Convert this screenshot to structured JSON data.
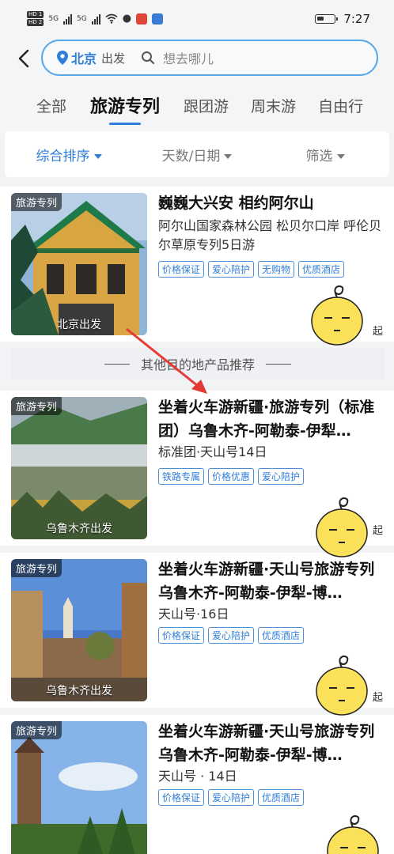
{
  "status_bar": {
    "hd1": "HD 1",
    "hd2": "HD 2",
    "sig1": "5G",
    "sig2": "5G",
    "time": "7:27"
  },
  "search": {
    "city": "北京",
    "depart_label": "出发",
    "placeholder": "想去哪儿"
  },
  "tabs": [
    {
      "label": "全部"
    },
    {
      "label": "旅游专列"
    },
    {
      "label": "跟团游"
    },
    {
      "label": "周末游"
    },
    {
      "label": "自由行"
    }
  ],
  "filters": [
    {
      "label": "综合排序"
    },
    {
      "label": "天数/日期"
    },
    {
      "label": "筛选"
    }
  ],
  "divider_text": "其他目的地产品推荐",
  "price_suffix": "起",
  "products": [
    {
      "badge": "旅游专列",
      "thumb_caption": "北京出发",
      "title": "巍巍大兴安 相约阿尔山",
      "subtitle": "阿尔山国家森林公园 松贝尔口岸 呼伦贝尔草原专列5日游",
      "tags": [
        "价格保证",
        "爱心陪护",
        "无购物",
        "优质酒店"
      ]
    },
    {
      "badge": "旅游专列",
      "thumb_caption": "乌鲁木齐出发",
      "title": "坐着火车游新疆·旅游专列（标准团）乌鲁木齐-阿勒泰-伊犁…",
      "subtitle": "标准团·天山号14日",
      "tags": [
        "铁路专属",
        "价格优惠",
        "爱心陪护"
      ]
    },
    {
      "badge": "旅游专列",
      "thumb_caption": "乌鲁木齐出发",
      "title": "坐着火车游新疆·天山号旅游专列 乌鲁木齐-阿勒泰-伊犁-博…",
      "subtitle": "天山号·16日",
      "tags": [
        "价格保证",
        "爱心陪护",
        "优质酒店"
      ]
    },
    {
      "badge": "旅游专列",
      "thumb_caption": "",
      "title": "坐着火车游新疆·天山号旅游专列 乌鲁木齐-阿勒泰-伊犁-博…",
      "subtitle": "天山号 · 14日",
      "tags": [
        "价格保证",
        "爱心陪护",
        "优质酒店"
      ]
    }
  ],
  "colors": {
    "accent": "#2f7ed8",
    "annotation_arrow": "#e53935"
  }
}
